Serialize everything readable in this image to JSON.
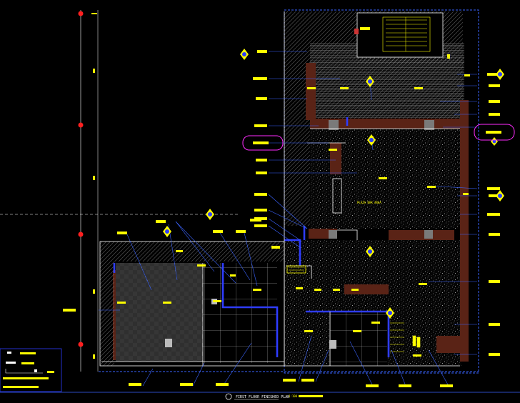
{
  "drawing": {
    "title": "FIRST FLOOR FINISHED PLAN",
    "scale_label": "1:100",
    "room_label": "PLAZA BAR AREA"
  },
  "colors": {
    "background": "#000000",
    "tag_yellow": "#ffff00",
    "wall_blue": "#2e3cff",
    "leader_blue": "#3a63ff",
    "grid_red": "#ff2020",
    "furniture_brown": "#5a2316",
    "callout_magenta": "#ff2cff",
    "hatch_grey": "#9a9a9a",
    "tile_white": "#ffffff"
  },
  "icons": [
    "section-marker-icon",
    "grid-bubble-icon",
    "leader-tag-icon",
    "stair-icon"
  ]
}
